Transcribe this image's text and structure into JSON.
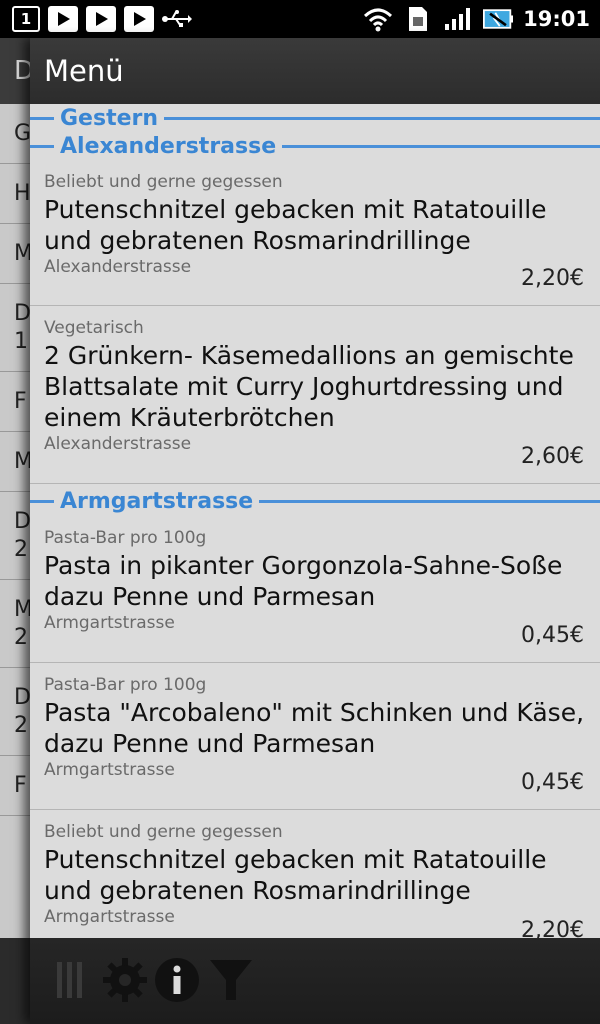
{
  "status_bar": {
    "calendar_day": "1",
    "time": "19:01",
    "icons": [
      "calendar-icon",
      "play-store-icon",
      "play-store-icon",
      "play-store-icon",
      "usb-icon",
      "wifi-icon",
      "sim-icon",
      "signal-icon",
      "battery-icon"
    ]
  },
  "background": {
    "header_letter": "D",
    "rows": [
      "G",
      "H",
      "M",
      "D\n1",
      "F",
      "M",
      "D\n2",
      "M\n2",
      "D\n2",
      "F"
    ]
  },
  "drawer": {
    "title": "Menü",
    "sections": [
      {
        "label": "Gestern"
      },
      {
        "label": "Alexanderstrasse",
        "items": [
          {
            "category": "Beliebt und gerne gegessen",
            "name": "Putenschnitzel gebacken mit Ratatouille und gebratenen Rosmarindrillinge",
            "location": "Alexanderstrasse",
            "price": "2,20€"
          },
          {
            "category": "Vegetarisch",
            "name": "2 Grünkern- Käsemedallions an gemischte Blattsalate mit Curry Joghurtdressing und einem Kräuterbrötchen",
            "location": "Alexanderstrasse",
            "price": "2,60€"
          }
        ]
      },
      {
        "label": "Armgartstrasse",
        "items": [
          {
            "category": "Pasta-Bar pro 100g",
            "name": "Pasta in pikanter Gorgonzola-Sahne-Soße dazu Penne und Parmesan",
            "location": "Armgartstrasse",
            "price": "0,45€"
          },
          {
            "category": "Pasta-Bar pro 100g",
            "name": "Pasta \"Arcobaleno\" mit Schinken und Käse, dazu Penne und Parmesan",
            "location": "Armgartstrasse",
            "price": "0,45€"
          },
          {
            "category": "Beliebt und gerne gegessen",
            "name": "Putenschnitzel gebacken mit Ratatouille und gebratenen Rosmarindrillinge",
            "location": "Armgartstrasse",
            "price": "2,20€"
          }
        ]
      }
    ]
  },
  "toolbar": {
    "icons": [
      "drag-handle-icon",
      "settings-gear-icon",
      "info-icon",
      "filter-icon"
    ]
  },
  "colors": {
    "accent": "#3a86d3",
    "list_background": "#dcdcdc",
    "bar_background": "#262626"
  }
}
